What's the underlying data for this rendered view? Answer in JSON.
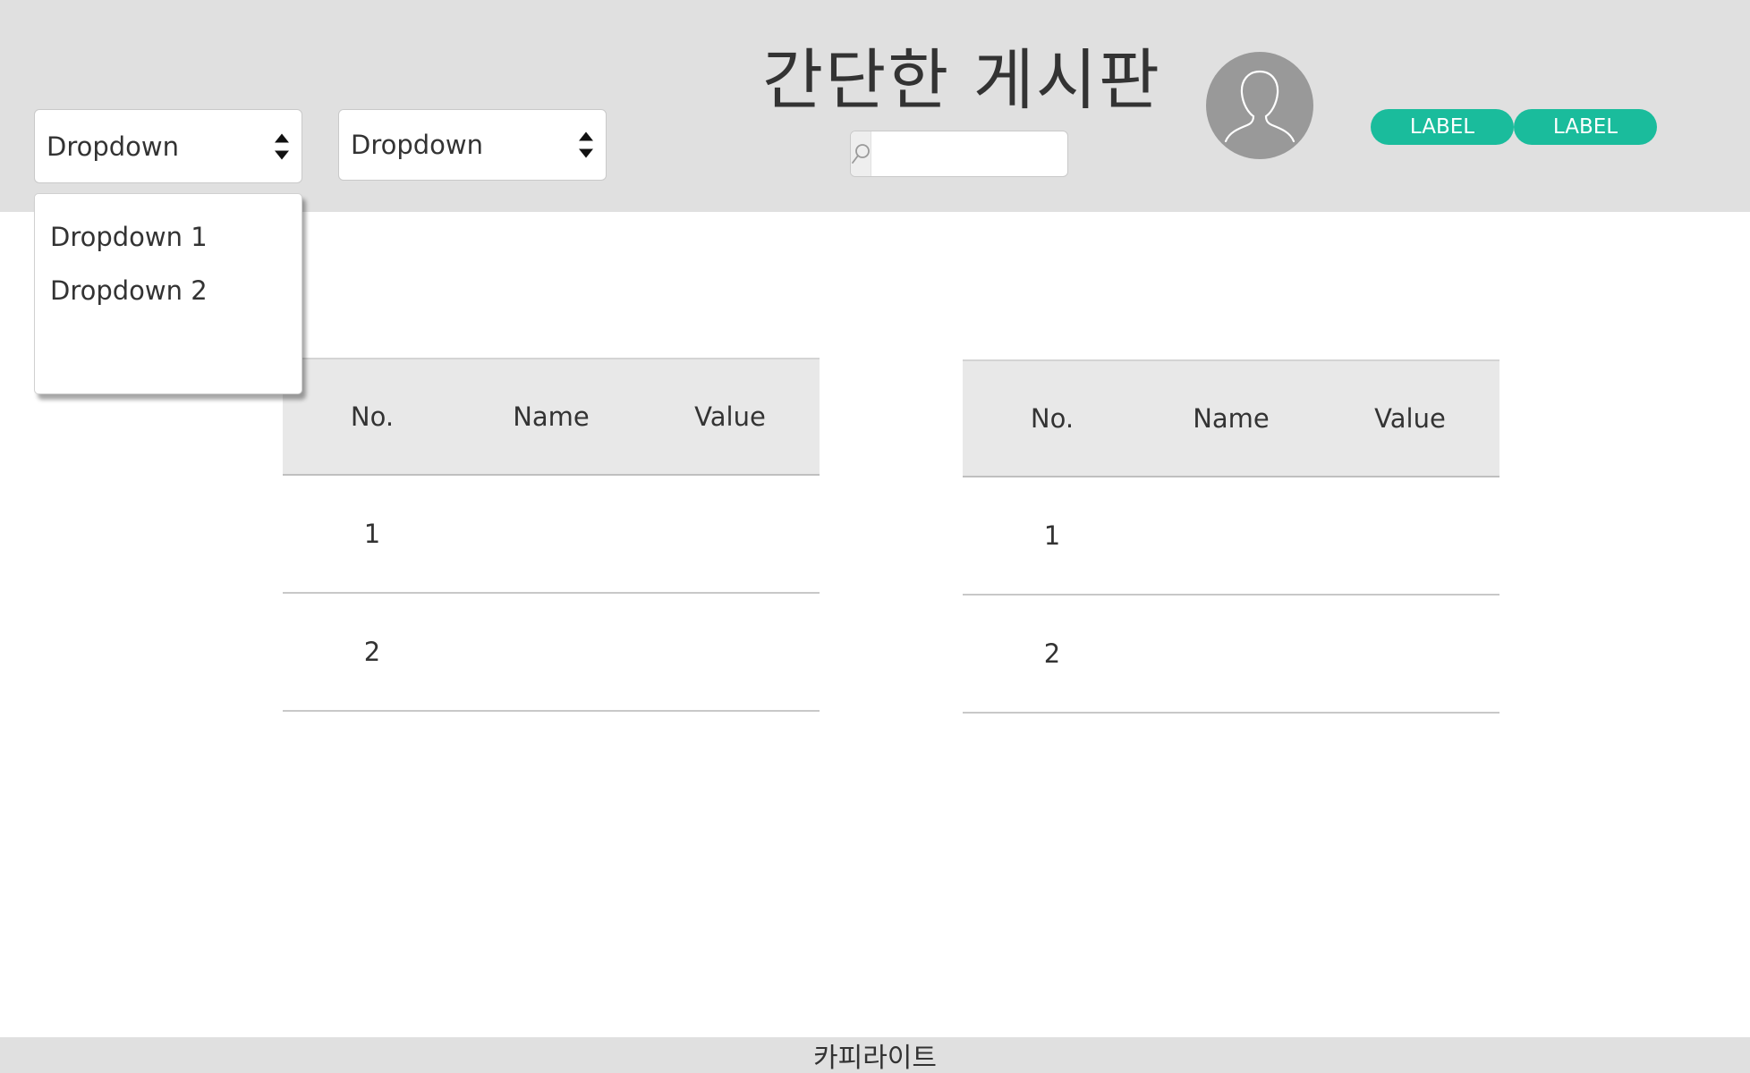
{
  "header": {
    "title": "간단한 게시판",
    "dropdown1": {
      "value": "Dropdown"
    },
    "dropdown2": {
      "value": "Dropdown"
    },
    "search": {
      "placeholder": ""
    },
    "labels": [
      "LABEL",
      "LABEL"
    ],
    "accent_color": "#1abc9c"
  },
  "dropdown_menu": {
    "items": [
      "Dropdown 1",
      "Dropdown 2"
    ]
  },
  "tables": [
    {
      "columns": [
        "No.",
        "Name",
        "Value"
      ],
      "rows": [
        [
          "1",
          "",
          ""
        ],
        [
          "2",
          "",
          ""
        ]
      ]
    },
    {
      "columns": [
        "No.",
        "Name",
        "Value"
      ],
      "rows": [
        [
          "1",
          "",
          ""
        ],
        [
          "2",
          "",
          ""
        ]
      ]
    }
  ],
  "footer": {
    "text": "카피라이트"
  },
  "icons": {
    "search": "search-icon",
    "avatar": "user-avatar-icon",
    "select_arrows": "up-down-arrows-icon"
  }
}
